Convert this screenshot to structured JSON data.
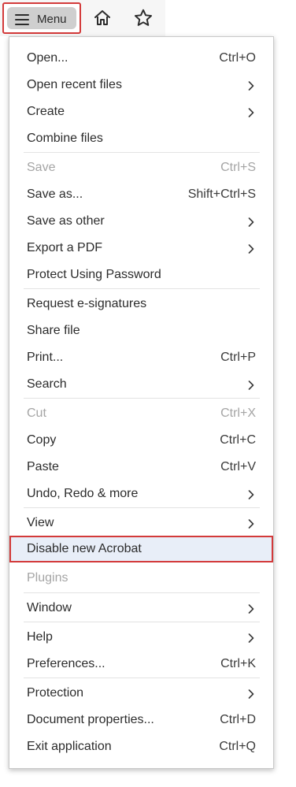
{
  "toolbar": {
    "menu_label": "Menu"
  },
  "menu": {
    "items": [
      {
        "label": "Open...",
        "shortcut": "Ctrl+O",
        "submenu": false,
        "disabled": false
      },
      {
        "label": "Open recent files",
        "shortcut": "",
        "submenu": true,
        "disabled": false
      },
      {
        "label": "Create",
        "shortcut": "",
        "submenu": true,
        "disabled": false
      },
      {
        "label": "Combine files",
        "shortcut": "",
        "submenu": false,
        "disabled": false
      },
      {
        "label": "Save",
        "shortcut": "Ctrl+S",
        "submenu": false,
        "disabled": true
      },
      {
        "label": "Save as...",
        "shortcut": "Shift+Ctrl+S",
        "submenu": false,
        "disabled": false
      },
      {
        "label": "Save as other",
        "shortcut": "",
        "submenu": true,
        "disabled": false
      },
      {
        "label": "Export a PDF",
        "shortcut": "",
        "submenu": true,
        "disabled": false
      },
      {
        "label": "Protect Using Password",
        "shortcut": "",
        "submenu": false,
        "disabled": false
      },
      {
        "label": "Request e-signatures",
        "shortcut": "",
        "submenu": false,
        "disabled": false
      },
      {
        "label": "Share file",
        "shortcut": "",
        "submenu": false,
        "disabled": false
      },
      {
        "label": "Print...",
        "shortcut": "Ctrl+P",
        "submenu": false,
        "disabled": false
      },
      {
        "label": "Search",
        "shortcut": "",
        "submenu": true,
        "disabled": false
      },
      {
        "label": "Cut",
        "shortcut": "Ctrl+X",
        "submenu": false,
        "disabled": true
      },
      {
        "label": "Copy",
        "shortcut": "Ctrl+C",
        "submenu": false,
        "disabled": false
      },
      {
        "label": "Paste",
        "shortcut": "Ctrl+V",
        "submenu": false,
        "disabled": false
      },
      {
        "label": "Undo, Redo & more",
        "shortcut": "",
        "submenu": true,
        "disabled": false
      },
      {
        "label": "View",
        "shortcut": "",
        "submenu": true,
        "disabled": false
      },
      {
        "label": "Disable new Acrobat",
        "shortcut": "",
        "submenu": false,
        "disabled": false,
        "highlighted": true
      },
      {
        "label": "Plugins",
        "shortcut": "",
        "submenu": false,
        "disabled": true
      },
      {
        "label": "Window",
        "shortcut": "",
        "submenu": true,
        "disabled": false
      },
      {
        "label": "Help",
        "shortcut": "",
        "submenu": true,
        "disabled": false
      },
      {
        "label": "Preferences...",
        "shortcut": "Ctrl+K",
        "submenu": false,
        "disabled": false
      },
      {
        "label": "Protection",
        "shortcut": "",
        "submenu": true,
        "disabled": false
      },
      {
        "label": "Document properties...",
        "shortcut": "Ctrl+D",
        "submenu": false,
        "disabled": false
      },
      {
        "label": "Exit application",
        "shortcut": "Ctrl+Q",
        "submenu": false,
        "disabled": false
      }
    ]
  },
  "colors": {
    "highlight_border": "#d33a3a",
    "highlight_bg": "#e8eef8",
    "disabled_text": "#a5a5a5"
  }
}
